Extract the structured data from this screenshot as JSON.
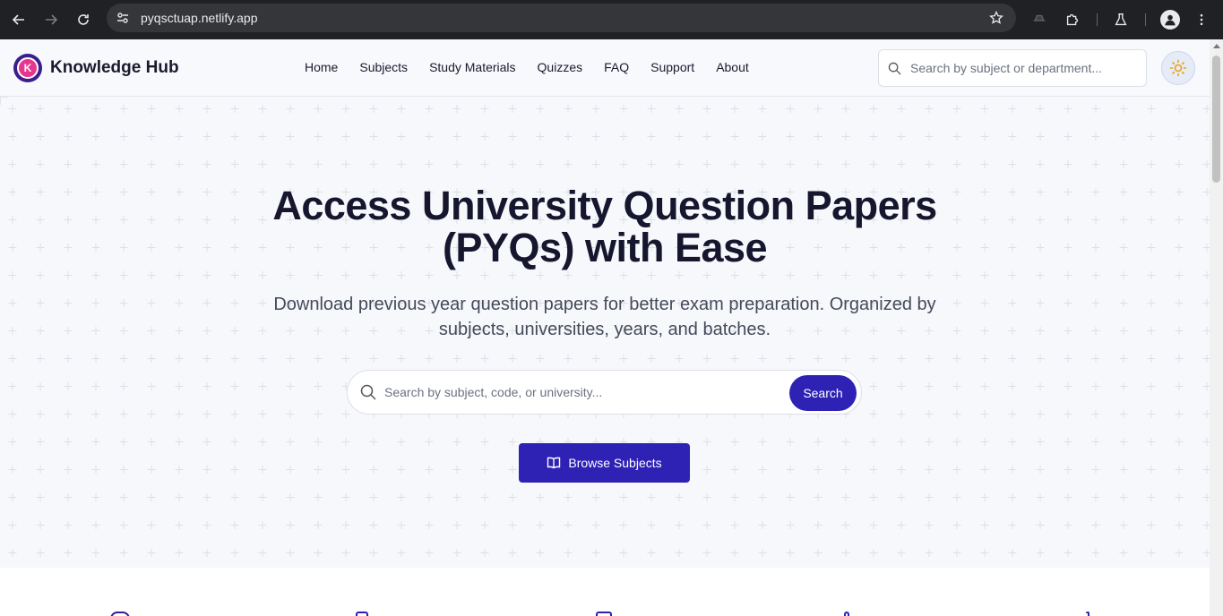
{
  "browser": {
    "url": "pyqsctuap.netlify.app"
  },
  "header": {
    "logo_text": "Knowledge Hub",
    "logo_letter": "K",
    "nav": [
      {
        "label": "Home"
      },
      {
        "label": "Subjects"
      },
      {
        "label": "Study Materials"
      },
      {
        "label": "Quizzes"
      },
      {
        "label": "FAQ"
      },
      {
        "label": "Support"
      },
      {
        "label": "About"
      }
    ],
    "search_placeholder": "Search by subject or department...",
    "theme_toggle_icon": "sun-icon"
  },
  "hero": {
    "title_line1": "Access University Question Papers",
    "title_line2": "(PYQs) with Ease",
    "subtitle_line1": "Download previous year question papers for better exam preparation. Organized by",
    "subtitle_line2": "subjects, universities, years, and batches.",
    "search_placeholder": "Search by subject, code, or university...",
    "search_button": "Search",
    "browse_button": "Browse Subjects"
  },
  "colors": {
    "primary": "#2e22b5",
    "logo_accent": "#e8368f",
    "hero_bg": "#f7f8fb"
  }
}
